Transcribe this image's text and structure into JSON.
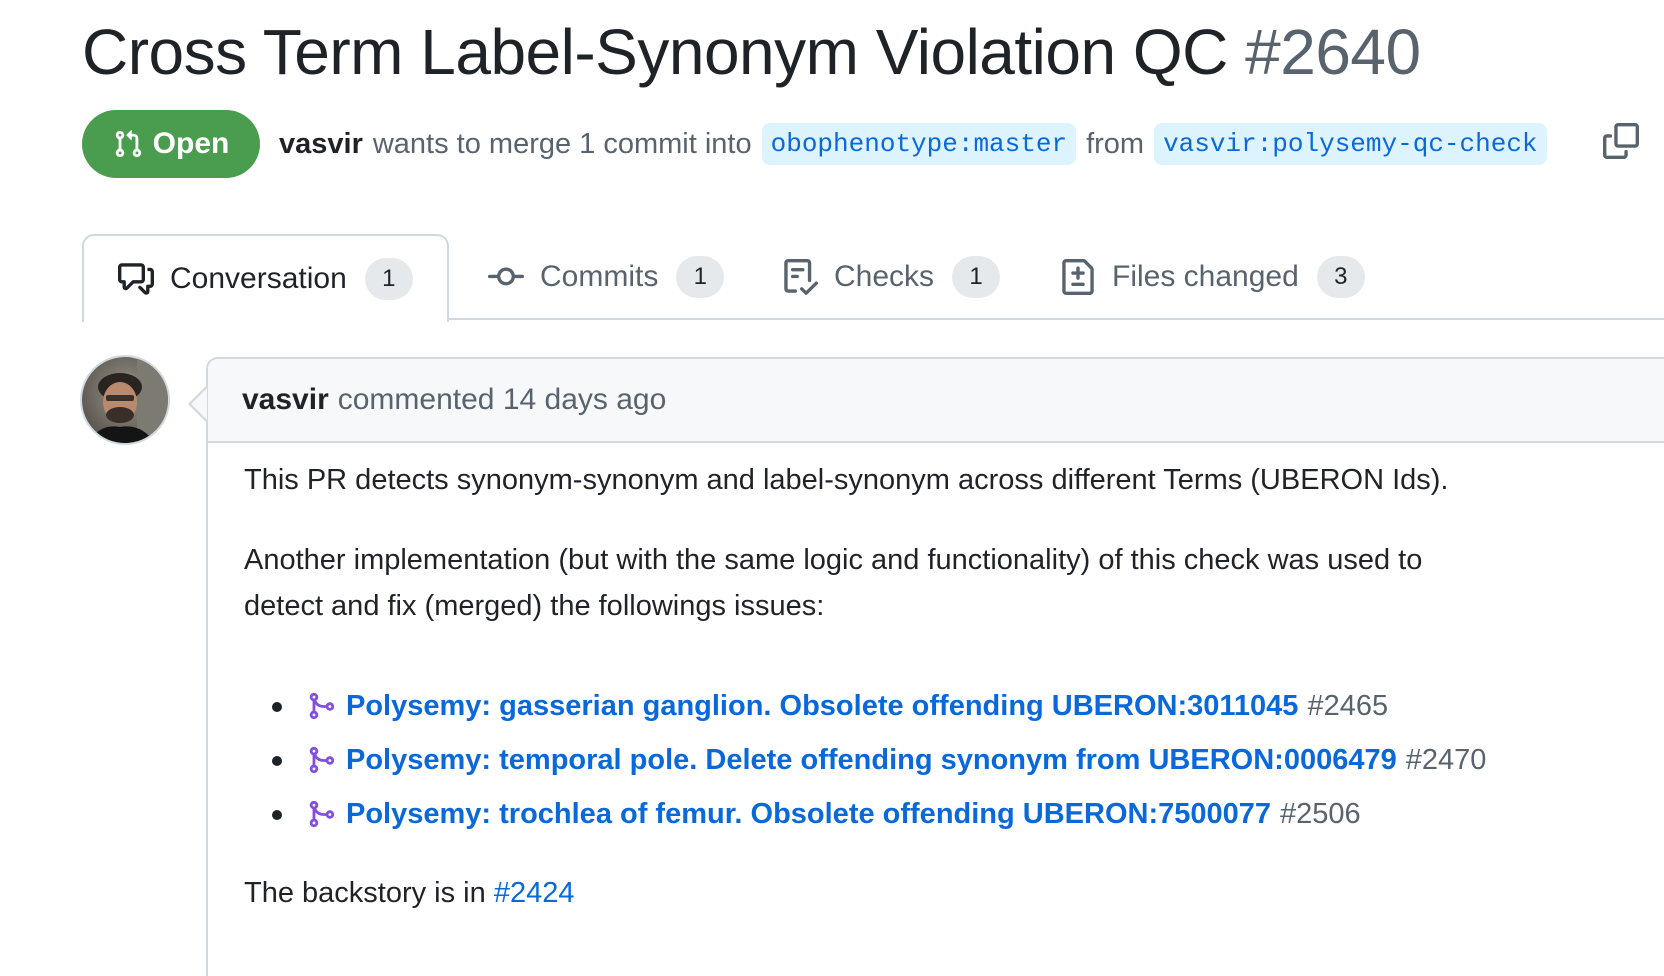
{
  "pr": {
    "title": "Cross Term Label-Synonym Violation QC",
    "number": "#2640",
    "state": "Open",
    "author": "vasvir",
    "merge_text": "wants to merge 1 commit into",
    "base_branch": "obophenotype:master",
    "from_text": "from",
    "head_branch": "vasvir:polysemy-qc-check"
  },
  "tabs": [
    {
      "label": "Conversation",
      "count": "1",
      "icon": "comment-discussion-icon",
      "active": true
    },
    {
      "label": "Commits",
      "count": "1",
      "icon": "git-commit-icon"
    },
    {
      "label": "Checks",
      "count": "1",
      "icon": "checklist-icon"
    },
    {
      "label": "Files changed",
      "count": "3",
      "icon": "file-diff-icon"
    }
  ],
  "comment": {
    "author": "vasvir",
    "action": "commented 14 days ago",
    "paragraph_1": "This PR detects synonym-synonym and label-synonym across different Terms (UBERON Ids).",
    "paragraph_2": "Another implementation (but with the same logic and functionality) of this check was used to detect and fix (merged) the followings issues:",
    "issues": [
      {
        "title": "Polysemy: gasserian ganglion. Obsolete offending UBERON:3011045",
        "ref": "#2465"
      },
      {
        "title": "Polysemy: temporal pole. Delete offending synonym from UBERON:0006479",
        "ref": "#2470"
      },
      {
        "title": "Polysemy: trochlea of femur. Obsolete offending UBERON:7500077",
        "ref": "#2506"
      }
    ],
    "backstory_text": "The backstory is in",
    "backstory_link": "#2424"
  },
  "colors": {
    "open_green": "#4a9d4f",
    "link_blue": "#0969da",
    "merged_purple": "#8250df",
    "branch_bg": "#ddf4ff"
  }
}
